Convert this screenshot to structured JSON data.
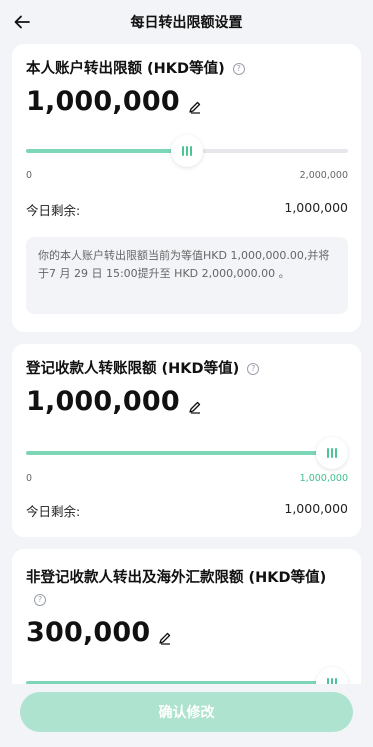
{
  "header": {
    "title": "每日转出限额设置",
    "back_icon": "arrow-left-icon"
  },
  "cards": [
    {
      "title": "本人账户转出限额 (HKD等值)",
      "amount": "1,000,000",
      "slider": {
        "min_label": "0",
        "max_label": "2,000,000",
        "fraction": 0.5
      },
      "remain_label": "今日剩余:",
      "remain_value": "1,000,000",
      "note": "你的本人账户转出限额当前为等值HKD 1,000,000.00,并将于7 月 29 日 15:00提升至 HKD 2,000,000.00 。"
    },
    {
      "title": "登记收款人转账限额 (HKD等值)",
      "amount": "1,000,000",
      "slider": {
        "min_label": "0",
        "max_label": "1,000,000",
        "fraction": 1.0
      },
      "remain_label": "今日剩余:",
      "remain_value": "1,000,000"
    },
    {
      "title": "非登记收款人转出及海外汇款限额 (HKD等值)",
      "amount": "300,000",
      "slider": {
        "fraction": 1.0
      }
    }
  ],
  "footer": {
    "confirm_label": "确认修改"
  },
  "colors": {
    "accent": "#7dd6b6",
    "button": "#aee3cf",
    "background": "#f3f4f8"
  }
}
